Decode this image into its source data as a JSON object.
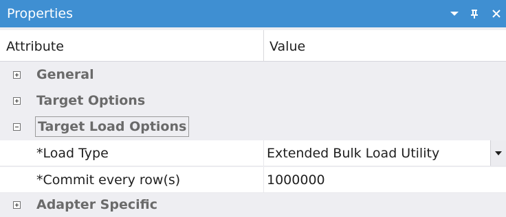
{
  "panel": {
    "title": "Properties",
    "controls": {
      "menu_icon": "chevron-down-icon",
      "pin_icon": "pin-icon",
      "close_icon": "close-icon"
    }
  },
  "columns": {
    "attribute": "Attribute",
    "value": "Value"
  },
  "categories": [
    {
      "label": "General",
      "state": "collapsed"
    },
    {
      "label": "Target Options",
      "state": "collapsed"
    },
    {
      "label": "Target Load Options",
      "state": "expanded"
    },
    {
      "label": "Adapter Specific",
      "state": "collapsed"
    }
  ],
  "properties": [
    {
      "name": "*Load Type",
      "value": "Extended Bulk Load Utility",
      "has_dropdown": true
    },
    {
      "name": "*Commit every row(s)",
      "value": "1000000"
    }
  ],
  "colors": {
    "title_bar": "#3f8fd2",
    "category_text": "#6a6a6a",
    "background": "#eeeef2"
  }
}
